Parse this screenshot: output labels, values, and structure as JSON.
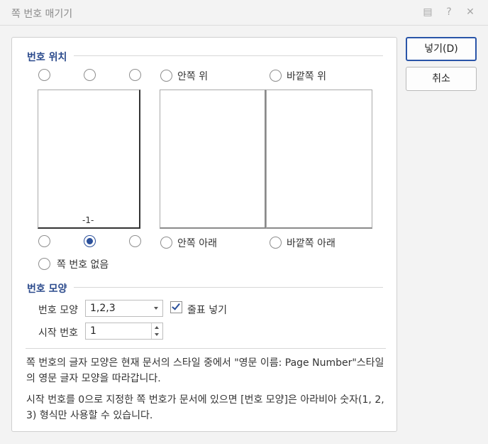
{
  "window": {
    "title": "쪽 번호 매기기",
    "icons": [
      "comment-icon",
      "help-icon",
      "close-icon"
    ]
  },
  "position_section": {
    "title": "번호 위치",
    "inner_top_label": "안쪽 위",
    "outer_top_label": "바깥쪽 위",
    "inner_bottom_label": "안쪽 아래",
    "outer_bottom_label": "바깥쪽 아래",
    "no_number_label": "쪽 번호 없음",
    "preview_number": "-1-",
    "selected": "bottom-center"
  },
  "format_section": {
    "title": "번호 모양",
    "style_label": "번호 모양",
    "style_value": "1,2,3",
    "dash_label": "줄표 넣기",
    "dash_checked": true,
    "start_label": "시작 번호",
    "start_value": "1"
  },
  "notes": {
    "note1": "쪽 번호의 글자 모양은 현재 문서의 스타일 중에서 \"영문 이름: Page Number\"스타일의 영문 글자 모양을 따라갑니다.",
    "note2": "시작 번호를 0으로 지정한 쪽 번호가 문서에 있으면 [번호 모양]은 아라비아 숫자(1, 2, 3) 형식만 사용할 수 있습니다."
  },
  "buttons": {
    "insert": "넣기(D)",
    "cancel": "취소"
  },
  "colors": {
    "accent": "#2a4f9a",
    "section_title": "#2b4a8c"
  }
}
